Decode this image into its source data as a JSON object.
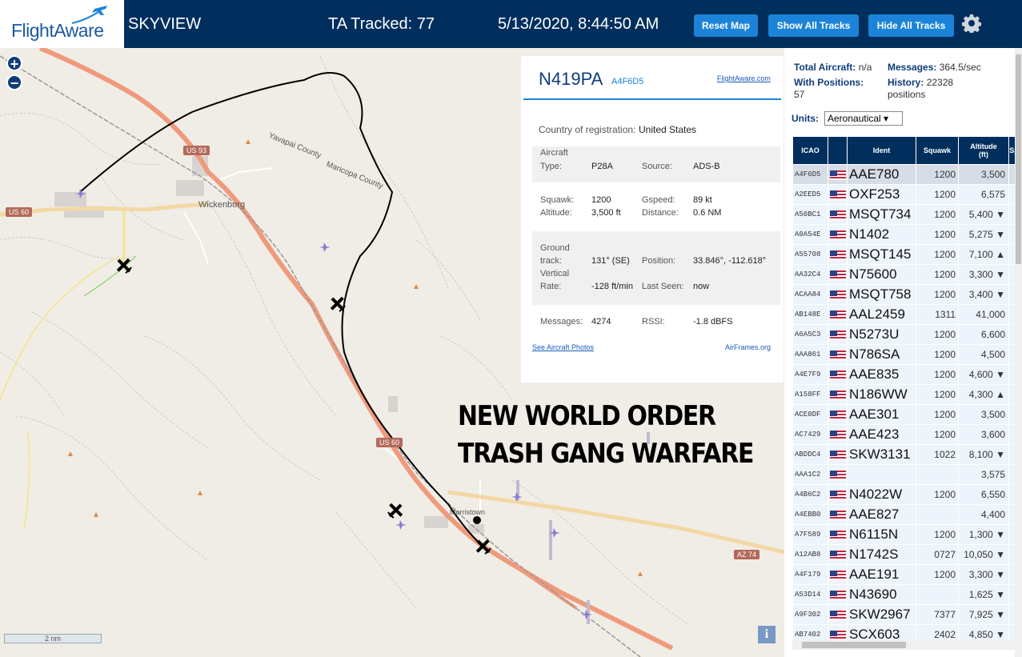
{
  "header": {
    "logo": "FlightAware",
    "app_title": "SKYVIEW",
    "tracked": "TA Tracked: 77",
    "datetime": "5/13/2020, 8:44:50 AM",
    "buttons": {
      "reset": "Reset Map",
      "show_all": "Show All Tracks",
      "hide_all": "Hide All Tracks"
    },
    "icons": {
      "settings": "gear-icon"
    }
  },
  "map": {
    "zoom_in": "+",
    "zoom_out": "−",
    "scale_label": "2 nm",
    "info_label": "i",
    "labels": {
      "wickenburg": "Wickenburg",
      "yavapai": "Yavapai County",
      "maricopa": "Maricopa County",
      "morristown": "Morristown",
      "us93": "US 93",
      "us60_west": "US 60",
      "us60_mid": "US 60",
      "az74": "AZ 74"
    },
    "overlay_line1": "NEW WORLD ORDER",
    "overlay_line2": "TRASH GANG WARFARE"
  },
  "details": {
    "callsign": "N419PA",
    "hex": "A4F6D5",
    "fa_link": "FlightAware.com",
    "country_label": "Country of registration:",
    "country": "United States",
    "aircraft_type_label_1": "Aircraft",
    "aircraft_type_label_2": "Type:",
    "aircraft_type": "P28A",
    "source_label": "Source:",
    "source": "ADS-B",
    "squawk_label": "Squawk:",
    "squawk": "1200",
    "gspeed_label": "Gspeed:",
    "gspeed": "89 kt",
    "altitude_label": "Altitude:",
    "altitude": "3,500 ft",
    "distance_label": "Distance:",
    "distance": "0.6 NM",
    "track_label_1": "Ground",
    "track_label_2": "track:",
    "track": "131° (SE)",
    "position_label": "Position:",
    "position": "33.846°, -112.618°",
    "vrate_label_1": "Vertical",
    "vrate_label_2": "Rate:",
    "vrate": "-128 ft/min",
    "lastseen_label": "Last Seen:",
    "lastseen": "now",
    "messages_label": "Messages:",
    "messages": "4274",
    "rssi_label": "RSSI:",
    "rssi": "-1.8 dBFS",
    "photos_link": "See Aircraft Photos",
    "airframes_link": "AirFrames.org"
  },
  "panel": {
    "total_label": "Total Aircraft:",
    "total_value": "n/a",
    "messages_label": "Messages:",
    "messages_value": "364.5/sec",
    "positions_label": "With Positions:",
    "positions_value": "57",
    "history_label": "History:",
    "history_value_1": "22328",
    "history_value_2": "positions",
    "units_label": "Units:",
    "units_value": "Aeronautical ▾",
    "columns": {
      "icao": "ICAO",
      "ident": "Ident",
      "squawk": "Squawk",
      "altitude_1": "Altitude",
      "altitude_2": "(ft)",
      "speed": "Sp"
    },
    "rows": [
      {
        "icao": "A4F6D5",
        "ident": "AAE780",
        "squawk": "1200",
        "alt": "3,500"
      },
      {
        "icao": "A2EED5",
        "ident": "OXF253",
        "squawk": "1200",
        "alt": "6,575"
      },
      {
        "icao": "A50BC1",
        "ident": "MSQT734",
        "squawk": "1200",
        "alt": "5,400 ▼"
      },
      {
        "icao": "A0A54E",
        "ident": "N1402",
        "squawk": "1200",
        "alt": "5,275 ▼"
      },
      {
        "icao": "A55708",
        "ident": "MSQT145",
        "squawk": "1200",
        "alt": "7,100 ▲"
      },
      {
        "icao": "AA32C4",
        "ident": "N75600",
        "squawk": "1200",
        "alt": "3,300 ▼"
      },
      {
        "icao": "ACAA84",
        "ident": "MSQT758",
        "squawk": "1200",
        "alt": "3,400 ▼"
      },
      {
        "icao": "AB148E",
        "ident": "AAL2459",
        "squawk": "1311",
        "alt": "41,000"
      },
      {
        "icao": "A6A5C3",
        "ident": "N5273U",
        "squawk": "1200",
        "alt": "6,600"
      },
      {
        "icao": "AAA861",
        "ident": "N786SA",
        "squawk": "1200",
        "alt": "4,500"
      },
      {
        "icao": "A4E7F9",
        "ident": "AAE835",
        "squawk": "1200",
        "alt": "4,600 ▼"
      },
      {
        "icao": "A158FF",
        "ident": "N186WW",
        "squawk": "1200",
        "alt": "4,300 ▲"
      },
      {
        "icao": "ACE0DF",
        "ident": "AAE301",
        "squawk": "1200",
        "alt": "3,500"
      },
      {
        "icao": "AC7429",
        "ident": "AAE423",
        "squawk": "1200",
        "alt": "3,600"
      },
      {
        "icao": "ABDDC4",
        "ident": "SKW3131",
        "squawk": "1022",
        "alt": "8,100 ▼"
      },
      {
        "icao": "AAA1C2",
        "ident": "",
        "squawk": "",
        "alt": "3,575"
      },
      {
        "icao": "A4B6C2",
        "ident": "N4022W",
        "squawk": "1200",
        "alt": "6,550"
      },
      {
        "icao": "A4EBB0",
        "ident": "AAE827",
        "squawk": "",
        "alt": "4,400"
      },
      {
        "icao": "A7F589",
        "ident": "N6115N",
        "squawk": "1200",
        "alt": "1,300 ▼"
      },
      {
        "icao": "A12AB8",
        "ident": "N1742S",
        "squawk": "0727",
        "alt": "10,050 ▼"
      },
      {
        "icao": "A4F179",
        "ident": "AAE191",
        "squawk": "1200",
        "alt": "3,300 ▼"
      },
      {
        "icao": "A53D14",
        "ident": "N43690",
        "squawk": "",
        "alt": "1,625 ▼"
      },
      {
        "icao": "A9F302",
        "ident": "SKW2967",
        "squawk": "7377",
        "alt": "7,925 ▼"
      },
      {
        "icao": "AB7402",
        "ident": "SCX603",
        "squawk": "2402",
        "alt": "4,850 ▼"
      }
    ]
  }
}
